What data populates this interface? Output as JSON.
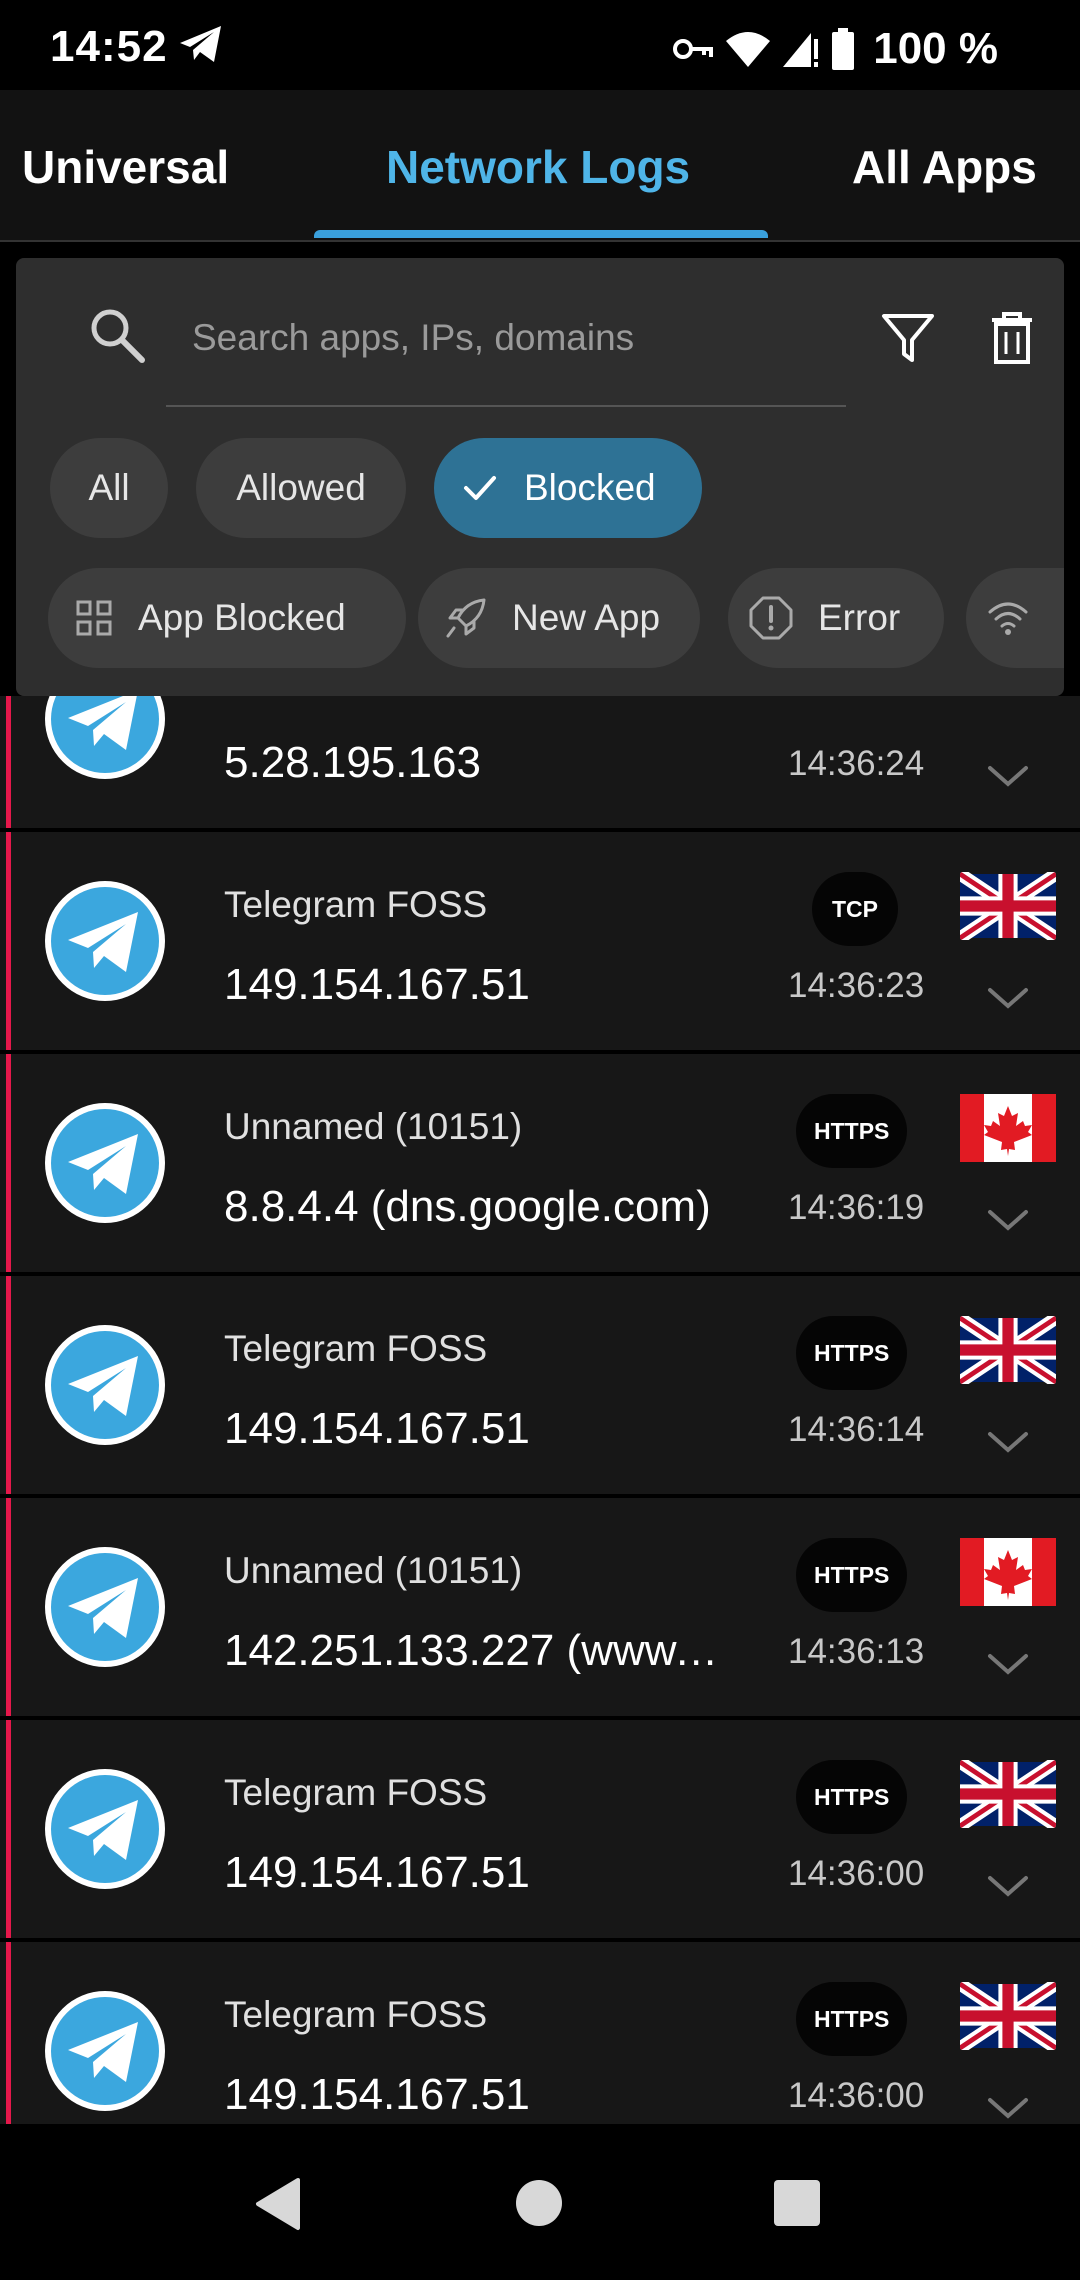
{
  "status_bar": {
    "time": "14:52",
    "battery_text": "100 %",
    "icons": [
      "telegram-icon",
      "vpn-key-icon",
      "wifi-icon",
      "cell-signal-icon",
      "battery-icon"
    ]
  },
  "tabs": [
    {
      "label": "Universal",
      "active": false
    },
    {
      "label": "Network Logs",
      "active": true
    },
    {
      "label": "All Apps",
      "active": false
    }
  ],
  "search": {
    "placeholder": "Search apps, IPs, domains",
    "value": ""
  },
  "filters": {
    "row1": [
      "All",
      "Allowed",
      "Blocked"
    ],
    "selected": "Blocked",
    "row2": [
      "App Blocked",
      "New App",
      "Error"
    ]
  },
  "colors": {
    "accent": "#4fb5e8",
    "blocked_bar": "#e5184b",
    "chip_selected": "#2e7295"
  },
  "logs": [
    {
      "app": "",
      "ip": "5.28.195.163",
      "protocol": "",
      "time": "14:36:24",
      "country": "partial-flag"
    },
    {
      "app": "Telegram FOSS",
      "ip": "149.154.167.51",
      "protocol": "TCP",
      "time": "14:36:23",
      "country": "UK"
    },
    {
      "app": "Unnamed (10151)",
      "ip": "8.8.4.4 (dns.google.com)",
      "protocol": "HTTPS",
      "time": "14:36:19",
      "country": "CA"
    },
    {
      "app": "Telegram FOSS",
      "ip": "149.154.167.51",
      "protocol": "HTTPS",
      "time": "14:36:14",
      "country": "UK"
    },
    {
      "app": "Unnamed (10151)",
      "ip": "142.251.133.227 (www.…",
      "protocol": "HTTPS",
      "time": "14:36:13",
      "country": "CA"
    },
    {
      "app": "Telegram FOSS",
      "ip": "149.154.167.51",
      "protocol": "HTTPS",
      "time": "14:36:00",
      "country": "UK"
    },
    {
      "app": "Telegram FOSS",
      "ip": "149.154.167.51",
      "protocol": "HTTPS",
      "time": "14:36:00",
      "country": "UK"
    }
  ]
}
